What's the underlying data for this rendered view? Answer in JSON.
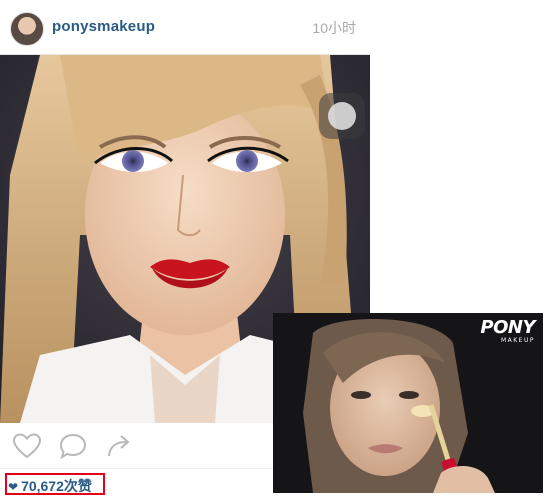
{
  "post": {
    "username": "ponysmakeup",
    "timestamp": "10小时",
    "likes": "70,672次赞",
    "likes_icon": "heart-icon",
    "actions": [
      "heart-outline-icon",
      "comment-icon",
      "share-icon"
    ],
    "highlight_color": "#e3001b",
    "link_color": "#2b5b84"
  },
  "inset": {
    "brand": "PONY",
    "brand_sub": "MAKEUP"
  }
}
